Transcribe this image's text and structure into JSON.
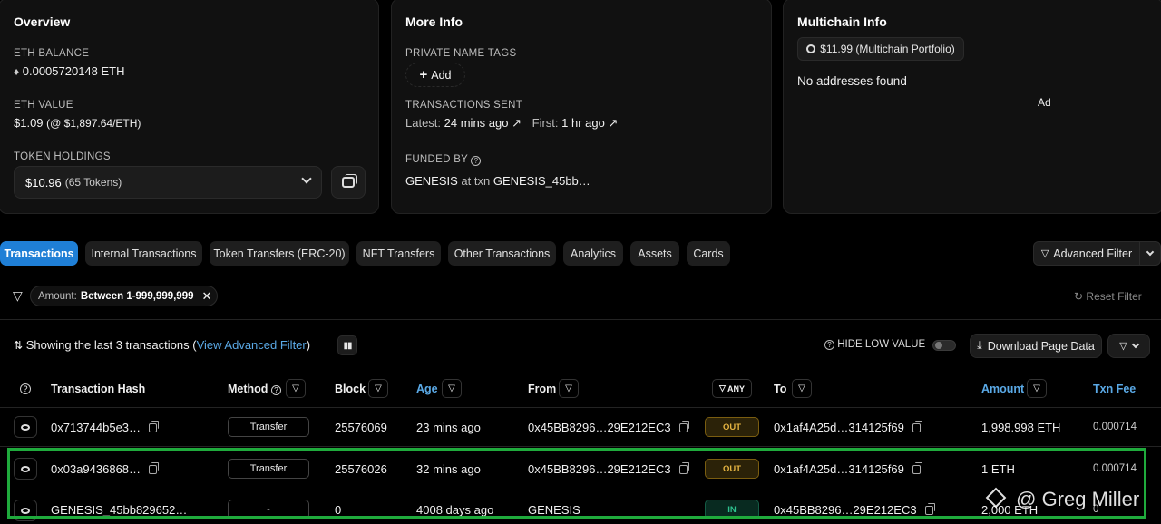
{
  "overview": {
    "title": "Overview",
    "eth_balance_label": "ETH BALANCE",
    "eth_balance": "0.0005720148 ETH",
    "eth_value_label": "ETH VALUE",
    "eth_value": "$1.09",
    "eth_price": "(@ $1,897.64/ETH)",
    "token_holdings_label": "TOKEN HOLDINGS",
    "token_holdings_value": "$10.96",
    "token_holdings_count": "(65 Tokens)"
  },
  "more_info": {
    "title": "More Info",
    "private_tags_label": "PRIVATE NAME TAGS",
    "add_label": "Add",
    "tx_sent_label": "TRANSACTIONS SENT",
    "latest_label": "Latest:",
    "latest_value": "24 mins ago",
    "first_label": "First:",
    "first_value": "1 hr ago",
    "funded_by_label": "FUNDED BY",
    "funded_by_source": "GENESIS",
    "funded_by_at": "at txn",
    "funded_by_txn": "GENESIS_45bb…"
  },
  "multichain": {
    "title": "Multichain Info",
    "portfolio_badge": "$11.99 (Multichain Portfolio)",
    "no_addresses": "No addresses found",
    "ad_label": "Ad"
  },
  "tabs": [
    {
      "label": "Transactions",
      "active": true
    },
    {
      "label": "Internal Transactions"
    },
    {
      "label": "Token Transfers (ERC-20)"
    },
    {
      "label": "NFT Transfers"
    },
    {
      "label": "Other Transactions"
    },
    {
      "label": "Analytics"
    },
    {
      "label": "Assets"
    },
    {
      "label": "Cards"
    }
  ],
  "advanced_filter_label": "Advanced Filter",
  "filter": {
    "chip_label": "Amount:",
    "chip_value": "Between 1-999,999,999",
    "reset_label": "Reset Filter"
  },
  "summary": {
    "showing_text": "Showing the last 3 transactions (",
    "view_advanced_filter": "View Advanced Filter",
    "close_paren": ")",
    "hide_low_value": "HIDE LOW VALUE",
    "download": "Download Page Data"
  },
  "table": {
    "headers": {
      "hash": "Transaction Hash",
      "method": "Method",
      "block": "Block",
      "age": "Age",
      "from": "From",
      "any": "ANY",
      "to": "To",
      "amount": "Amount",
      "fee": "Txn Fee"
    },
    "rows": [
      {
        "hash": "0x713744b5e3…",
        "method": "Transfer",
        "block": "25576069",
        "age": "23 mins ago",
        "from": "0x45BB8296…29E212EC3",
        "dir": "OUT",
        "to": "0x1af4A25d…314125f69",
        "amount": "1,998.998 ETH",
        "fee": "0.000714"
      },
      {
        "hash": "0x03a9436868…",
        "method": "Transfer",
        "block": "25576026",
        "age": "32 mins ago",
        "from": "0x45BB8296…29E212EC3",
        "dir": "OUT",
        "to": "0x1af4A25d…314125f69",
        "amount": "1 ETH",
        "fee": "0.000714"
      },
      {
        "hash": "GENESIS_45bb829652…",
        "method": "-",
        "block": "0",
        "age": "4008 days ago",
        "from": "GENESIS",
        "dir": "IN",
        "to": "0x45BB8296…29E212EC3",
        "amount": "2,000 ETH",
        "fee": "0"
      }
    ]
  },
  "watermark": "@ Greg Miller",
  "colors": {
    "accent": "#1f7fd6",
    "link": "#5aa9e6",
    "out": "#e3b341",
    "in": "#2ec28f",
    "highlight": "#1faa3c"
  }
}
